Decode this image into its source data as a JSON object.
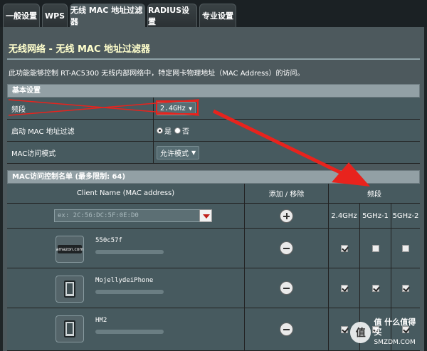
{
  "tabs": [
    {
      "label": "一般设置",
      "active": false
    },
    {
      "label": "WPS",
      "active": false
    },
    {
      "label": "无线 MAC 地址过滤器",
      "active": true
    },
    {
      "label": "RADIUS设置",
      "active": false
    },
    {
      "label": "专业设置",
      "active": false
    }
  ],
  "page": {
    "title": "无线网络 - 无线 MAC 地址过滤器",
    "description": "此功能能够控制 RT-AC5300 无线内部网络中，特定网卡物理地址（MAC Address）的访问。"
  },
  "basic": {
    "header": "基本设置",
    "band_label": "频段",
    "band_value": "2.4GHz",
    "enable_label": "启动 MAC 地址过滤",
    "enable_yes": "是",
    "enable_no": "否",
    "mode_label": "MAC访问模式",
    "mode_value": "允许模式"
  },
  "maclist": {
    "header": "MAC访问控制名单 (最多限制: 64)",
    "col_client": "Client Name (MAC address)",
    "col_addremove": "添加 / 移除",
    "col_band": "频段",
    "bands": [
      "2.4GHz",
      "5GHz-1",
      "5GHz-2"
    ],
    "input_placeholder": "ex: 2C:56:DC:5F:0E:D0",
    "clients": [
      {
        "name": "550c57f",
        "icon": "amazon-icon",
        "icon_text": "amazon.com",
        "checks": [
          true,
          false,
          false
        ]
      },
      {
        "name": "MojellydeiPhone",
        "icon": "phone-icon",
        "checks": [
          true,
          true,
          true
        ]
      },
      {
        "name": "HM2",
        "icon": "phone-icon",
        "checks": [
          true,
          true,
          true
        ]
      }
    ]
  },
  "watermark": {
    "main": "值 什么值得买",
    "sub": "SMZDM.COM"
  },
  "colors": {
    "accent_red": "#e8231d",
    "title_yellow": "#ffffcc"
  }
}
